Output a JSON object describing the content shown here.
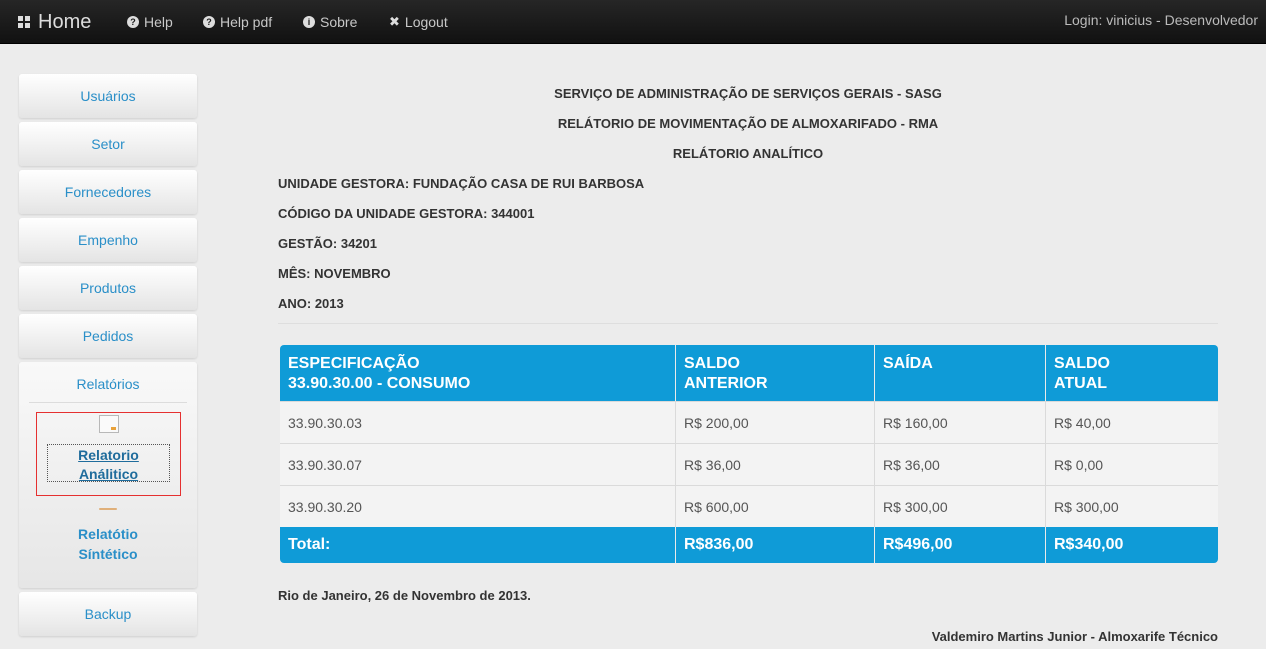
{
  "navbar": {
    "brand": "Home",
    "items": [
      {
        "label": "Help",
        "icon": "question-circle-icon"
      },
      {
        "label": "Help pdf",
        "icon": "question-circle-icon"
      },
      {
        "label": "Sobre",
        "icon": "info-circle-icon"
      },
      {
        "label": "Logout",
        "icon": "close-icon"
      }
    ],
    "login": "Login: vinicius - Desenvolvedor"
  },
  "sidebar": {
    "items": [
      "Usuários",
      "Setor",
      "Fornecedores",
      "Empenho",
      "Produtos",
      "Pedidos"
    ],
    "reports": {
      "title": "Relatórios",
      "analytic_line1": "Relatorio",
      "analytic_line2": "Análitico",
      "synthetic_line1": "Relatótio",
      "synthetic_line2": "Síntético"
    },
    "backup": "Backup"
  },
  "report": {
    "header1": "SERVIÇO DE ADMINISTRAÇÃO DE SERVIÇOS GERAIS - SASG",
    "header2": "RELÁTORIO DE MOVIMENTAÇÃO DE ALMOXARIFADO - RMA",
    "header3": "RELÁTORIO ANALÍTICO",
    "unidade": "UNIDADE GESTORA: FUNDAÇÃO CASA DE RUI BARBOSA",
    "codigo": "CÓDIGO DA UNIDADE GESTORA: 344001",
    "gestao": "GESTÃO: 34201",
    "mes": "MÊS: NOVEMBRO",
    "ano": "ANO: 2013",
    "table": {
      "headers": [
        {
          "line1": "ESPECIFICAÇÃO",
          "line2": "33.90.30.00 - CONSUMO"
        },
        {
          "line1": "SALDO",
          "line2": "ANTERIOR"
        },
        {
          "line1": "SAÍDA",
          "line2": ""
        },
        {
          "line1": "SALDO",
          "line2": "ATUAL"
        }
      ],
      "rows": [
        [
          "33.90.30.03",
          "R$ 200,00",
          "R$ 160,00",
          "R$ 40,00"
        ],
        [
          "33.90.30.07",
          "R$ 36,00",
          "R$ 36,00",
          "R$ 0,00"
        ],
        [
          "33.90.30.20",
          "R$ 600,00",
          "R$ 300,00",
          "R$ 300,00"
        ]
      ],
      "total": [
        "Total:",
        "R$836,00",
        "R$496,00",
        "R$340,00"
      ]
    },
    "date_line": "Rio de Janeiro, 26 de Novembro de 2013.",
    "signature": "Valdemiro Martins Junior - Almoxarife Técnico"
  },
  "colors": {
    "navbar_bg": "#111111",
    "accent_blue": "#0f9bd7",
    "link_blue": "#2a8fc8",
    "selection_border": "#e53030"
  }
}
